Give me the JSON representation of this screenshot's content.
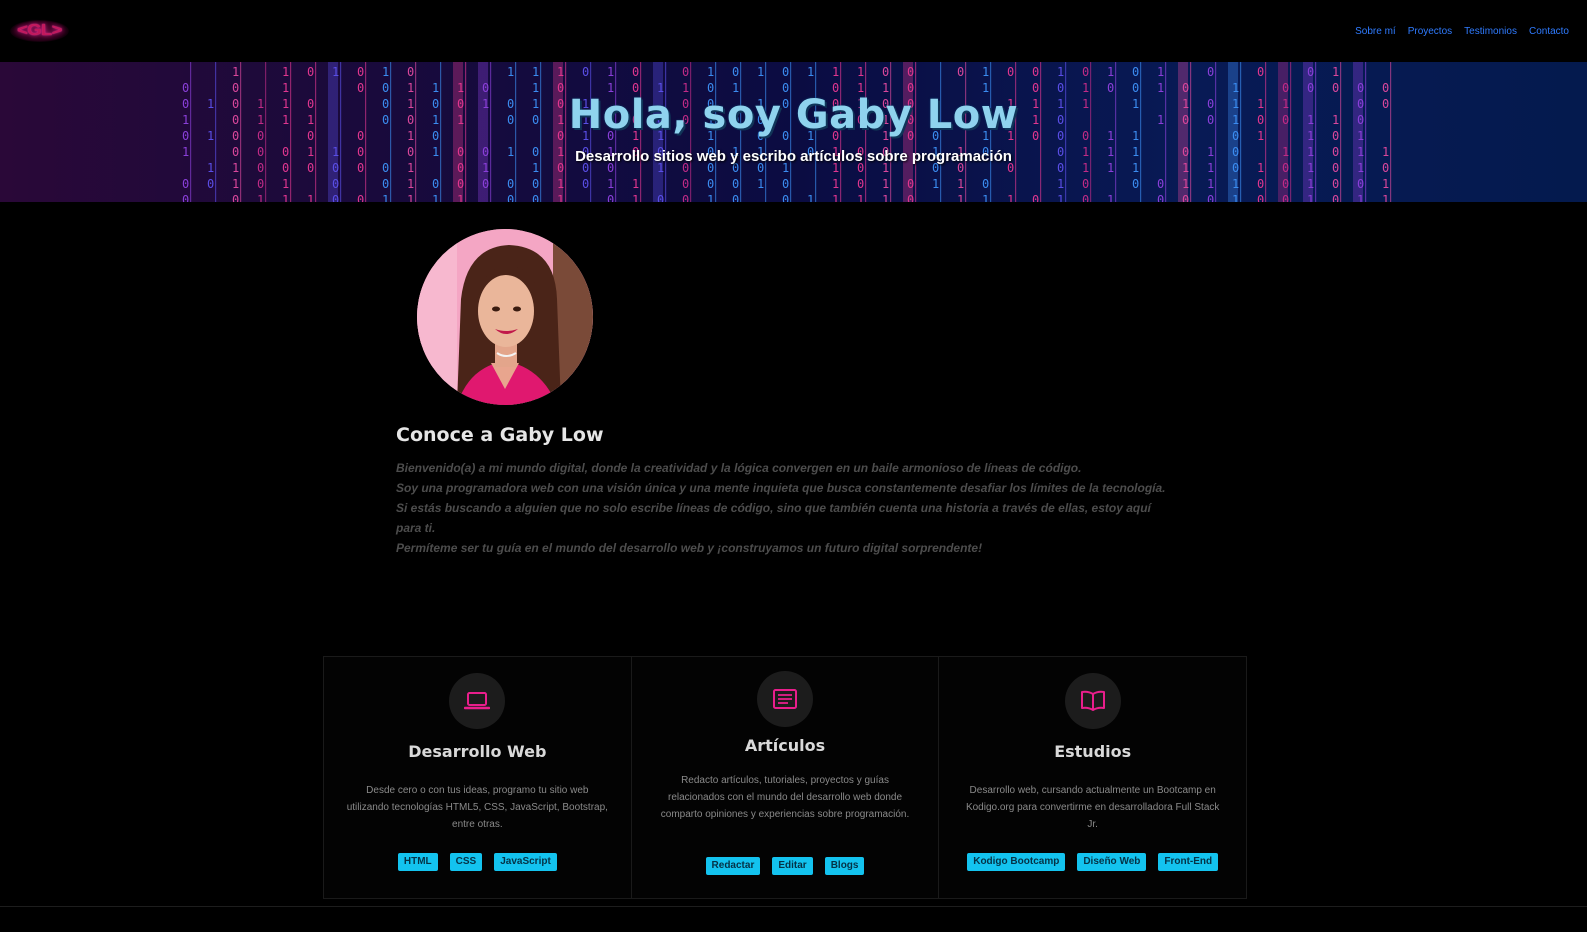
{
  "nav": {
    "logo": "<GL>",
    "links": [
      "Sobre mí",
      "Proyectos",
      "Testimonios",
      "Contacto"
    ]
  },
  "hero": {
    "title": "Hola, soy Gaby Low",
    "subtitle": "Desarrollo sitios web y escribo artículos sobre programación"
  },
  "about": {
    "title": "Conoce a Gaby Low",
    "paragraphs": [
      "Bienvenido(a) a mi mundo digital, donde la creatividad y la lógica convergen en un baile armonioso de líneas de código.",
      "Soy una programadora web con una visión única y una mente inquieta que busca constantemente desafiar los límites de la tecnología.",
      "Si estás buscando a alguien que no solo escribe líneas de código, sino que también cuenta una historia a través de ellas, estoy aquí para ti.",
      "Permíteme ser tu guía en el mundo del desarrollo web y ¡construyamos un futuro digital sorprendente!"
    ]
  },
  "services": [
    {
      "icon": "laptop-icon",
      "title": "Desarrollo Web",
      "description": "Desde cero o con tus ideas, programo tu sitio web utilizando tecnologías HTML5, CSS, JavaScript, Bootstrap, entre otras.",
      "tags": [
        "HTML",
        "CSS",
        "JavaScript"
      ]
    },
    {
      "icon": "article-icon",
      "title": "Artículos",
      "description": "Redacto artículos, tutoriales, proyectos y guías relacionados con el mundo del desarrollo web donde comparto opiniones y experiencias sobre programación.",
      "tags": [
        "Redactar",
        "Editar",
        "Blogs"
      ]
    },
    {
      "icon": "book-icon",
      "title": "Estudios",
      "description": "Desarrollo web, cursando actualmente un Bootcamp en Kodigo.org para convertirme en desarrolladora Full Stack Jr.",
      "tags": [
        "Kodigo Bootcamp",
        "Diseño Web",
        "Front-End"
      ]
    }
  ],
  "colors": {
    "accent": "#e91e8c",
    "tag_bg": "#13c3ef",
    "nav_link": "#2f7bff"
  }
}
